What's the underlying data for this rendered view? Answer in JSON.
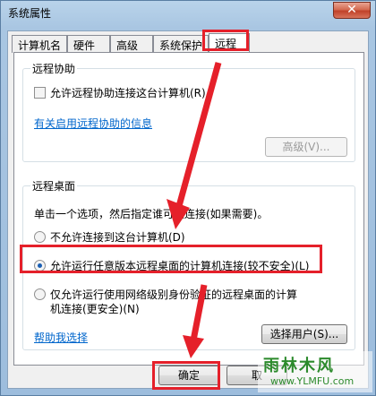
{
  "window": {
    "title": "系统属性",
    "close_glyph": "✕"
  },
  "tabs": [
    {
      "label": "计算机名"
    },
    {
      "label": "硬件"
    },
    {
      "label": "高级"
    },
    {
      "label": "系统保护"
    },
    {
      "label": "远程",
      "active": true
    }
  ],
  "remote_assistance": {
    "title": "远程协助",
    "allow_label": "允许远程协助连接这台计算机(R)",
    "allow_checked": false,
    "info_link": "有关启用远程协助的信息",
    "advanced_button": "高级(V)..."
  },
  "remote_desktop": {
    "title": "远程桌面",
    "instruction": "单击一个选项，然后指定谁可以连接(如果需要)。",
    "options": [
      {
        "label": "不允许连接到这台计算机(D)",
        "checked": false
      },
      {
        "label": "允许运行任意版本远程桌面的计算机连接(较不安全)(L)",
        "checked": true
      },
      {
        "label_line1": "仅允许运行使用网络级别身份验证的远程桌面的计算",
        "label_line2": "机连接(更安全)(N)",
        "checked": false
      }
    ],
    "help_link": "帮助我选择",
    "select_users_button": "选择用户(S)..."
  },
  "footer": {
    "ok_button": "确定",
    "cancel_button": "取"
  },
  "watermark": {
    "text": "雨林木风",
    "sub": "www.YLMFU.com"
  },
  "colors": {
    "annotation_red": "#e5202a",
    "link_blue": "#0066cc"
  }
}
